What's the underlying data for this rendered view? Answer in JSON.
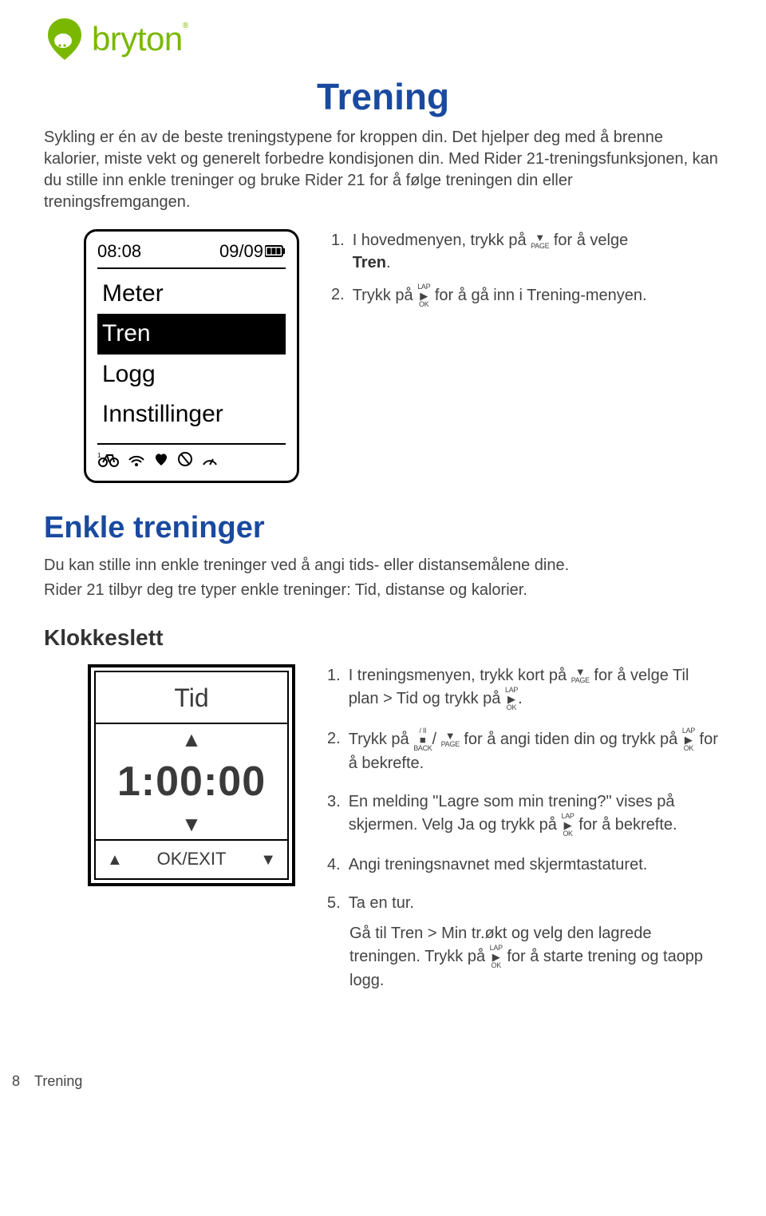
{
  "brand": {
    "name": "bryton"
  },
  "page": {
    "title": "Trening"
  },
  "intro": "Sykling er én av de beste treningstypene for kroppen din. Det hjelper deg med å brenne kalorier, miste vekt og generelt forbedre kondisjonen din. Med Rider 21-treningsfunksjonen, kan du stille inn enkle treninger og bruke Rider 21 for å følge treningen din eller treningsfremgangen.",
  "screen1": {
    "time": "08:08",
    "date": "09/09",
    "items": [
      "Meter",
      "Tren",
      "Logg",
      "Innstillinger"
    ]
  },
  "steps1": {
    "s1a": "I hovedmenyen, trykk på",
    "s1b": "for å velge",
    "s1c": "Tren",
    "s2a": "Trykk på",
    "s2b": "for å gå inn i Trening-menyen."
  },
  "keys": {
    "page": "PAGE",
    "ok_top": "LAP",
    "ok_bot": "OK",
    "back_top": "/ II",
    "back_bot": "BACK"
  },
  "section2": {
    "heading": "Enkle treninger",
    "p1": "Du kan stille inn enkle treninger ved å angi tids- eller distansemålene dine.",
    "p2": "Rider 21 tilbyr deg tre typer enkle treninger:  Tid, distanse og kalorier."
  },
  "sub": {
    "heading": "Klokkeslett"
  },
  "screen2": {
    "title": "Tid",
    "value": "1:00:00",
    "ok_exit": "OK/EXIT"
  },
  "steps2": {
    "s1a": "I treningsmenyen, trykk kort på",
    "s1b": "for å",
    "s1c": "velge",
    "s1d": "Til plan > Tid",
    "s1e": "og trykk på",
    "s2a": "Trykk på",
    "s2b": "for å angi tiden din og trykk på",
    "s2c": "for å bekrefte.",
    "s3a": "En melding \"Lagre som min trening?\" vises på skjermen. Velg",
    "s3b": "Ja",
    "s3c": "og trykk på",
    "s3d": "for å bekrefte.",
    "s4": "Angi treningsnavnet med skjermtastaturet.",
    "s5": "Ta en tur.",
    "s5suba": "Gå til",
    "s5subb": "Tren > Min tr.økt",
    "s5subc": "og velg den lagrede treningen. Trykk på",
    "s5subd": "for å starte trening og taopp logg."
  },
  "footer": {
    "page": "8",
    "section": "Trening"
  }
}
